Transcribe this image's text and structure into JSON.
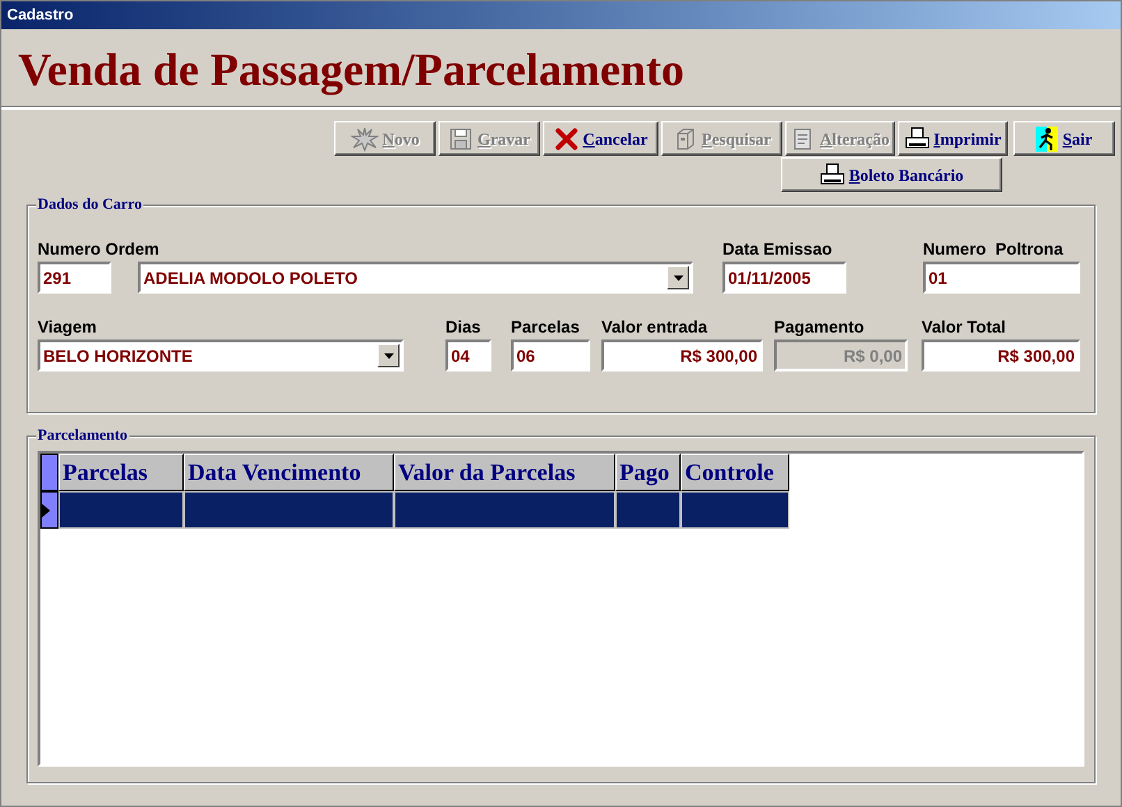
{
  "window": {
    "title": "Cadastro"
  },
  "heading": "Venda de Passagem/Parcelamento",
  "toolbar": [
    {
      "label": "Novo",
      "disabled": true
    },
    {
      "label": "Gravar",
      "disabled": true
    },
    {
      "label": "Cancelar",
      "disabled": false
    },
    {
      "label": "Pesquisar",
      "disabled": true
    },
    {
      "label": "Alteração",
      "disabled": true
    },
    {
      "label": "Imprimir",
      "disabled": false
    },
    {
      "label": "Sair",
      "disabled": false
    }
  ],
  "extra_button": {
    "label": "Boleto Bancário",
    "disabled": false
  },
  "dados_do_carro": {
    "title": "Dados do Carro",
    "fields": [
      {
        "label": "Numero Ordem",
        "value": "291",
        "kind": "text",
        "disabled": false
      },
      {
        "value": "ADELIA MODOLO POLETO",
        "kind": "combo",
        "disabled": false
      },
      {
        "label": "Data Emissao",
        "value": "01/11/2005",
        "kind": "text",
        "disabled": false
      },
      {
        "label": "Numero  Poltrona",
        "value": "01",
        "kind": "text",
        "disabled": false
      },
      {
        "label": "Viagem",
        "value": "BELO HORIZONTE",
        "kind": "combo",
        "disabled": false
      },
      {
        "label": "Dias",
        "value": "04",
        "kind": "text",
        "disabled": false
      },
      {
        "label": "Parcelas",
        "value": "06",
        "kind": "text",
        "disabled": false
      },
      {
        "label": "Valor entrada",
        "value": "R$ 300,00",
        "kind": "money",
        "disabled": false
      },
      {
        "label": "Pagamento",
        "value": "R$ 0,00",
        "kind": "money",
        "disabled": true
      },
      {
        "label": "Valor Total",
        "value": "R$ 300,00",
        "kind": "money",
        "disabled": false
      }
    ]
  },
  "parcelamento": {
    "title": "Parcelamento",
    "table": {
      "columns": [
        "Parcelas",
        "Data Vencimento",
        "Valor da Parcelas",
        "Pago",
        "Controle"
      ],
      "rows": [
        {
          "selected": true
        }
      ]
    }
  }
}
